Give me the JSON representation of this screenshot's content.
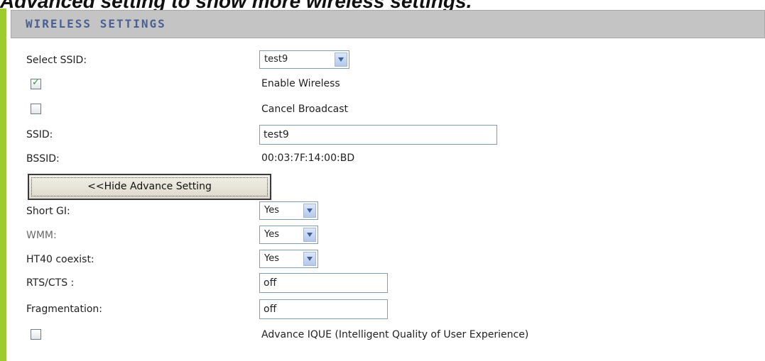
{
  "caption": "Advanced setting to show more wireless settings.",
  "header": {
    "title": "WIRELESS SETTINGS"
  },
  "select_ssid": {
    "label": "Select SSID:",
    "value": "test9"
  },
  "enable_wireless": {
    "label": "Enable Wireless",
    "checked": true
  },
  "cancel_broadcast": {
    "label": "Cancel Broadcast",
    "checked": false
  },
  "ssid": {
    "label": "SSID:",
    "value": "test9"
  },
  "bssid": {
    "label": "BSSID:",
    "value": "00:03:7F:14:00:BD"
  },
  "advance_button": {
    "label": "<<Hide Advance Setting"
  },
  "short_gi": {
    "label": "Short GI:",
    "value": "Yes"
  },
  "wmm": {
    "label": "WMM:",
    "value": "Yes"
  },
  "ht40": {
    "label": "HT40 coexist:",
    "value": "Yes"
  },
  "rts_cts": {
    "label": "RTS/CTS :",
    "value": "off"
  },
  "fragmentation": {
    "label": "Fragmentation:",
    "value": "off"
  },
  "ique": {
    "label": "Advance IQUE (Intelligent Quality of User Experience)",
    "checked": false
  },
  "colors": {
    "accent_bar": "#9ccc2e",
    "header_bg": "#c4c4c4",
    "header_text": "#4a5f93"
  }
}
